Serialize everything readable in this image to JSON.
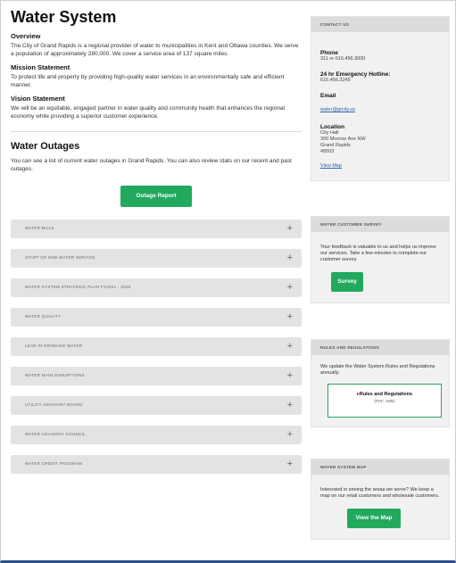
{
  "main": {
    "title": "Water System",
    "overview_h": "Overview",
    "overview_p": "The City of Grand Rapids is a regional provider of water to municipalities in Kent and Ottawa counties. We serve a population of approximately 280,000. We cover a service area of 137 square miles.",
    "mission_h": "Mission Statement",
    "mission_p": "To protect life and property by providing high-quality water services in an environmentally safe and efficient manner.",
    "vision_h": "Vision Statement",
    "vision_p": "We will be an equitable, engaged partner in water quality and community health that enhances the regional economy while providing a superior customer experience.",
    "outages_h": "Water Outages",
    "outages_p": "You can see a list of current water outages in Grand Rapids. You can also review stats on our recent and past outages.",
    "outage_button": "Outage Report",
    "accordion": [
      "WATER BILLS",
      "START OR END WATER SERVICE",
      "WATER SYSTEM STRATEGIC PLAN FY2021 - 2026",
      "WATER QUALITY",
      "LEAD IN DRINKING WATER",
      "WATER MAIN DISRUPTIONS",
      "UTILITY ADVISORY BOARD",
      "WATER ADVISORY COUNCIL",
      "WATER CREDIT PROGRAM"
    ],
    "plus_glyph": "+"
  },
  "sidebar": {
    "contact": {
      "header": "CONTACT US",
      "phone_label": "Phone",
      "phone_value": "311 or 616.456.3000",
      "emergency_label": "24 hr Emergency Hotline:",
      "emergency_value": "616.456.3249",
      "email_label": "Email",
      "email_value": "water@grcity.us",
      "location_label": "Location",
      "location_lines": [
        "City Hall",
        "300 Monroe Ave NW",
        "Grand Rapids",
        "49503"
      ],
      "map_link": "View Map"
    },
    "survey": {
      "header": "WATER CUSTOMER SURVEY",
      "text": "Your feedback is valuable to us and helps us improve our services. Take a few minutes to complete our customer survey.",
      "button": "Survey"
    },
    "rules": {
      "header": "RULES AND REGULATIONS",
      "text": "We update the Water System Rules and Regulations annually.",
      "link": "Rules and Regulations",
      "size": "(PDF, 1MB)"
    },
    "map": {
      "header": "WATER SYSTEM MAP",
      "text": "Interested in seeing the areas we serve? We keep a map on our retail customers and wholesale customers.",
      "button": "View the Map"
    }
  },
  "colors": {
    "accent_green": "#22a95e",
    "link_blue": "#2a62b5",
    "footer_bar": "#2b4e8c"
  }
}
